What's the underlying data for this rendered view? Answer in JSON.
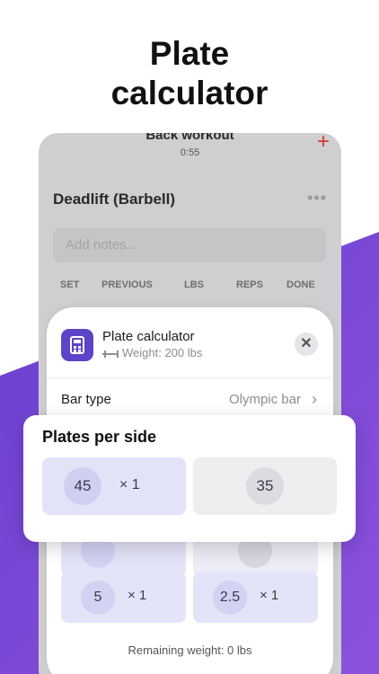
{
  "headline": "Plate\ncalculator",
  "headline_lines": [
    "Plate",
    "calculator"
  ],
  "workout": {
    "title": "Back workout",
    "timer": "0:55",
    "add_icon": "plus-icon",
    "exercise": "Deadlift (Barbell)",
    "more_icon": "ellipsis-icon",
    "notes_placeholder": "Add notes...",
    "columns": [
      "SET",
      "PREVIOUS",
      "LBS",
      "REPS",
      "DONE"
    ]
  },
  "sheet": {
    "title": "Plate calculator",
    "weight": "Weight: 200 lbs",
    "icon": "calculator-icon",
    "weight_icon": "dumbbell-icon",
    "close_icon": "close-icon",
    "bar_type_label": "Bar type",
    "bar_type_value": "Olympic bar",
    "remaining": "Remaining weight: 0 lbs"
  },
  "plates_card": {
    "title": "Plates per side",
    "plates": [
      {
        "weight": "45",
        "count": "× 1"
      },
      {
        "weight": "35",
        "count": ""
      }
    ]
  },
  "sheet_plates": [
    {
      "weight": "5",
      "count": "× 1"
    },
    {
      "weight": "2.5",
      "count": "× 1"
    }
  ],
  "colors": {
    "accent": "#5b44c7",
    "purple_bg": "#7a4ad6",
    "destructive": "#e0342c"
  }
}
